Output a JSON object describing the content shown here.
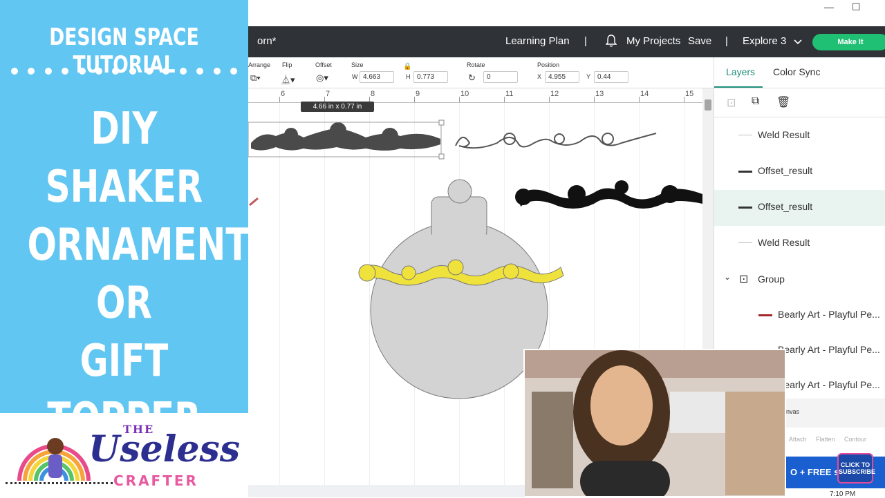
{
  "thumbnail": {
    "series_title": "DESIGN SPACE TUTORIAL",
    "title_lines": [
      "DIY",
      "SHAKER",
      "ORNAMENT",
      "OR",
      "GIFT TOPPER"
    ],
    "logo": {
      "the": "THE",
      "useless": "Useless",
      "crafter": "CRAFTER"
    },
    "colors": {
      "panel": "#62c6f2",
      "accent": "#1fbf74"
    }
  },
  "window": {
    "minimize": "—",
    "maximize": "☐"
  },
  "header": {
    "doc_name": "orn*",
    "learning_plan": "Learning Plan",
    "separator": "|",
    "my_projects": "My Projects",
    "save": "Save",
    "machine": "Explore 3",
    "make_it": "Make It"
  },
  "toolbar": {
    "arrange": "Arrange",
    "flip": "Flip",
    "offset": "Offset",
    "size": "Size",
    "w_label": "W",
    "w_value": "4.663",
    "h_label": "H",
    "h_value": "0.773",
    "rotate": "Rotate",
    "rotate_value": "0",
    "position": "Position",
    "x_label": "X",
    "x_value": "4.955",
    "y_label": "Y",
    "y_value": "0.44"
  },
  "ruler": [
    "6",
    "7",
    "8",
    "9",
    "10",
    "11",
    "12",
    "13",
    "14",
    "15"
  ],
  "canvas": {
    "size_tooltip": "4.66 in x 0.77 in"
  },
  "layers": {
    "tab_layers": "Layers",
    "tab_color_sync": "Color Sync",
    "rows": [
      {
        "label": "Weld Result"
      },
      {
        "label": "Offset_result"
      },
      {
        "label": "Offset_result"
      },
      {
        "label": "Weld Result"
      },
      {
        "label": "Group"
      },
      {
        "label": "Bearly Art - Playful Pe..."
      },
      {
        "label": "Bearly Art - Playful Pe..."
      },
      {
        "label": "Bearly Art - Playful Pe..."
      }
    ],
    "canvas_label": "nvas",
    "attach": "Attach",
    "flatten": "Flatten",
    "contour": "Contour",
    "promo": "O + FREE ship"
  },
  "subscribe": "CLICK TO SUBSCRIBE",
  "clock": "7:10 PM"
}
